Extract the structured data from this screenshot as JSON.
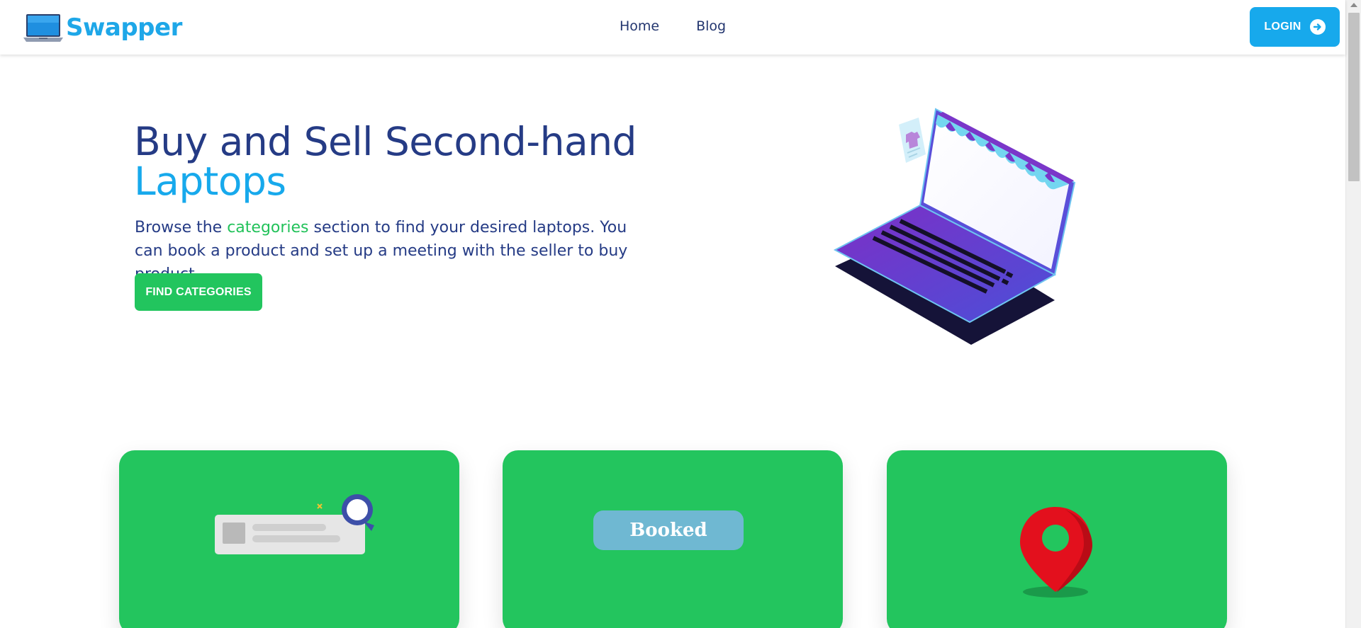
{
  "navbar": {
    "brand_name": "Swapper",
    "links": [
      "Home",
      "Blog"
    ],
    "login_label": "LOGIN"
  },
  "hero": {
    "title_line1": "Buy and Sell Second-hand",
    "title_line2": "Laptops",
    "desc_before": "Browse the ",
    "desc_link": "categories",
    "desc_after": " section to find your desired laptops. You can book a product and set up a meeting with the seller to buy product.",
    "cta_label": "FIND CATEGORIES"
  },
  "cards": [
    {
      "illustration": "search-listing-icon"
    },
    {
      "illustration": "booked-badge",
      "badge_text": "Booked"
    },
    {
      "illustration": "map-pin-icon"
    }
  ],
  "colors": {
    "primary_blue": "#17a9ec",
    "navy": "#253b85",
    "green": "#22c55e"
  }
}
